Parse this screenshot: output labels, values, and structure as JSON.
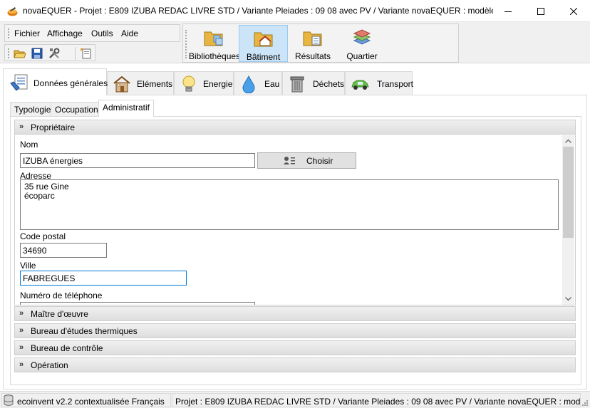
{
  "window": {
    "title": "novaEQUER -  Projet : E809 IZUBA REDAC LIVRE STD / Variante Pleiades : 09 08 avec PV / Variante novaEQUER : modèle référ...",
    "controls": [
      "minimize",
      "maximize",
      "close"
    ]
  },
  "menu": {
    "items": [
      {
        "label": "Fichier"
      },
      {
        "label": "Affichage"
      },
      {
        "label": "Outils"
      },
      {
        "label": "Aide"
      }
    ]
  },
  "toolbar": {
    "icons": [
      "open-folder-icon",
      "save-icon",
      "tools-icon",
      "new-document-icon"
    ]
  },
  "bigbar": {
    "buttons": [
      {
        "label": "Bibliothèques",
        "active": false
      },
      {
        "label": "Bâtiment",
        "active": true
      },
      {
        "label": "Résultats",
        "active": false
      },
      {
        "label": "Quartier",
        "active": false
      }
    ]
  },
  "main_tabs": [
    {
      "label": "Données générales",
      "icon": "general-data-icon",
      "active": true
    },
    {
      "label": "Eléments",
      "icon": "house-icon",
      "active": false
    },
    {
      "label": "Energie",
      "icon": "lightbulb-icon",
      "active": false
    },
    {
      "label": "Eau",
      "icon": "water-drop-icon",
      "active": false
    },
    {
      "label": "Déchets",
      "icon": "trash-bin-icon",
      "active": false
    },
    {
      "label": "Transport",
      "icon": "car-icon",
      "active": false
    }
  ],
  "sub_tabs": [
    {
      "label": "Typologie",
      "active": false
    },
    {
      "label": "Occupation",
      "active": false
    },
    {
      "label": "Administratif",
      "active": true
    }
  ],
  "sections": [
    {
      "label": "Propriétaire",
      "expanded": true
    },
    {
      "label": "Maître d'œuvre",
      "expanded": false
    },
    {
      "label": "Bureau d'études thermiques",
      "expanded": false
    },
    {
      "label": "Bureau de contrôle",
      "expanded": false
    },
    {
      "label": "Opération",
      "expanded": false
    }
  ],
  "owner": {
    "nom_label": "Nom",
    "nom_value": "IZUBA énergies",
    "choose_label": "Choisir",
    "adresse_label": "Adresse",
    "adresse_value": "35 rue Gine\nécoparc",
    "code_postal_label": "Code postal",
    "code_postal_value": "34690",
    "ville_label": "Ville",
    "ville_value": "FABREGUES",
    "telephone_label": "Numéro de téléphone"
  },
  "status": {
    "database": "ecoinvent v2.2 contextualisée Français",
    "project": "Projet : E809 IZUBA REDAC LIVRE STD / Variante Pleiades : 09 08 avec PV / Variante novaEQUER : modèle référ"
  }
}
